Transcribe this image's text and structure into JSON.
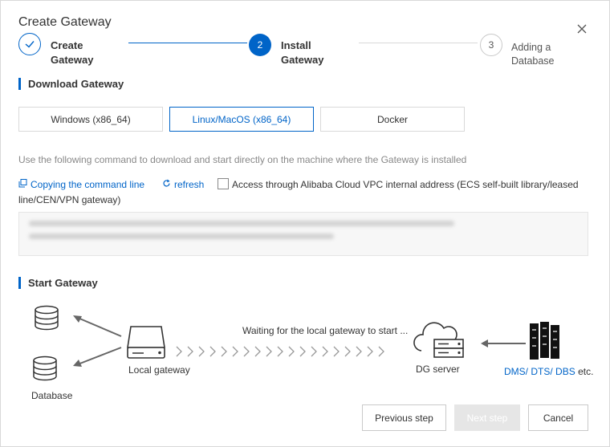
{
  "dialog": {
    "title": "Create Gateway",
    "close_label": "Close"
  },
  "steps": [
    {
      "number": "",
      "label": "Create Gateway",
      "status": "done"
    },
    {
      "number": "2",
      "label": "Install Gateway",
      "status": "current"
    },
    {
      "number": "3",
      "label": "Adding a Database",
      "status": "pending"
    }
  ],
  "download": {
    "section_title": "Download Gateway",
    "tabs": [
      "Windows (x86_64)",
      "Linux/MacOS (x86_64)",
      "Docker"
    ],
    "active_tab": "Linux/MacOS (x86_64)",
    "description": "Use the following command to download and start directly on the machine where the Gateway is installed",
    "copy_label": "Copying the command line",
    "refresh_label": "refresh",
    "vpc_checkbox_label": "Access through Alibaba Cloud VPC internal address (ECS self-built library/leased line/CEN/VPN gateway)",
    "vpc_checked": false
  },
  "start": {
    "section_title": "Start Gateway",
    "database_label": "Database",
    "local_gateway_label": "Local gateway",
    "waiting_text": "Waiting for the local gateway to start ...",
    "dg_server_label": "DG server",
    "dms_links": [
      "DMS/",
      "DTS/",
      "DBS"
    ],
    "etc_text": "etc."
  },
  "footer": {
    "previous_label": "Previous step",
    "next_label": "Next step",
    "cancel_label": "Cancel",
    "next_disabled": true
  },
  "colors": {
    "accent": "#0064c8",
    "muted": "#888888",
    "disabled": "#e6e6e6"
  }
}
